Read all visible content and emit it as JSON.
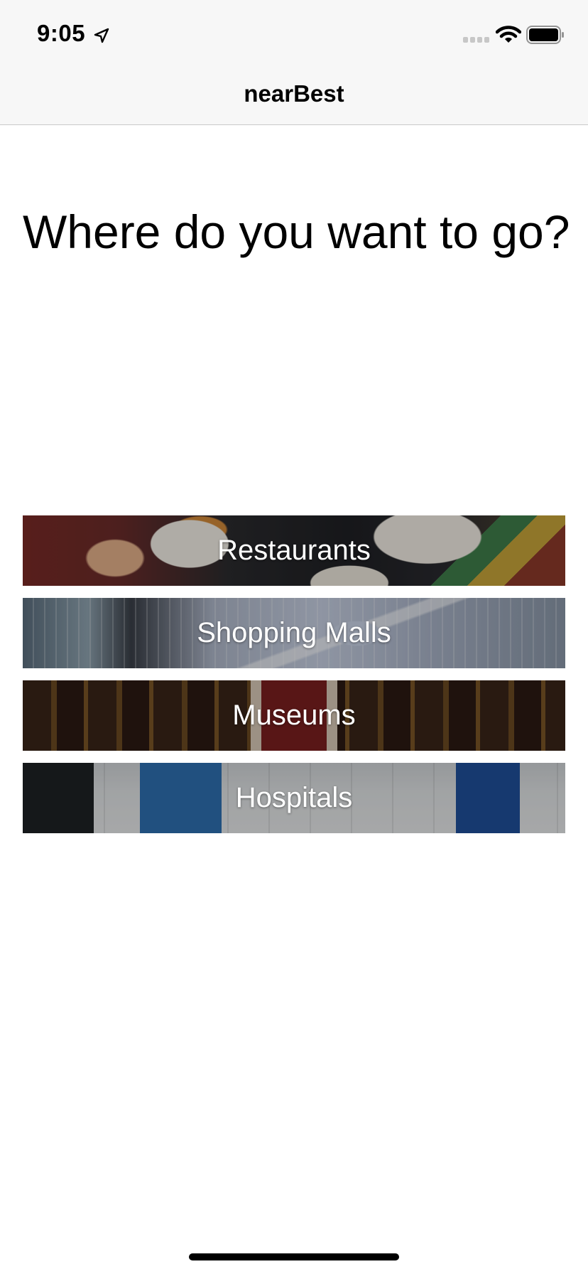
{
  "status_bar": {
    "time": "9:05",
    "icons": [
      "location-arrow-icon",
      "signal-icon",
      "wifi-icon",
      "battery-icon"
    ]
  },
  "nav": {
    "title": "nearBest"
  },
  "heading": "Where do you want to go?",
  "categories": [
    {
      "label": "Restaurants",
      "image": "restaurant-food-photo"
    },
    {
      "label": "Shopping Malls",
      "image": "mall-escalator-photo"
    },
    {
      "label": "Museums",
      "image": "museum-gallery-photo"
    },
    {
      "label": "Hospitals",
      "image": "hospital-lobby-photo"
    }
  ],
  "colors": {
    "nav_background": "#f7f7f7",
    "label_text": "#ffffff",
    "page_background": "#ffffff"
  }
}
